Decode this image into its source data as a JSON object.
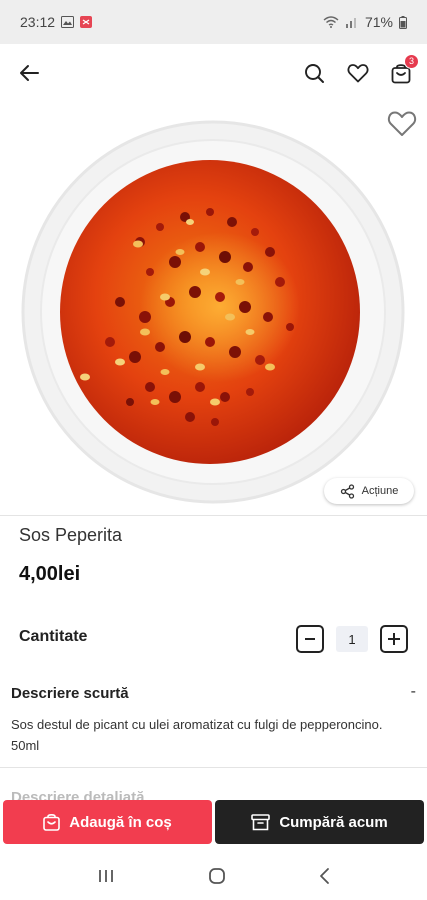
{
  "status_bar": {
    "time": "23:12",
    "battery": "71%",
    "icons": [
      "gallery-icon",
      "app-notification-icon",
      "wifi-icon",
      "signal-icon",
      "battery-icon"
    ]
  },
  "app_bar": {
    "icons": [
      "back-arrow-icon",
      "search-icon",
      "heart-icon",
      "cart-icon"
    ],
    "cart_count": "3"
  },
  "product": {
    "image_description_icon": "chili-oil-image",
    "share_label": "Acțiune",
    "name": "Sos Peperita",
    "price": "4,00lei"
  },
  "quantity": {
    "label": "Cantitate",
    "value": "1"
  },
  "description": {
    "title": "Descriere scurtă",
    "toggle": "-",
    "text": "Sos destul de picant cu ulei aromatizat cu fulgi de pepperoncino. 50ml"
  },
  "next_section": {
    "title": "Descriere detaliată"
  },
  "actions": {
    "add_to_cart": "Adaugă în coș",
    "buy_now": "Cumpără acum"
  },
  "colors": {
    "accent_red": "#f23d4f",
    "dark_button": "#222222",
    "badge": "#e63a4e"
  }
}
